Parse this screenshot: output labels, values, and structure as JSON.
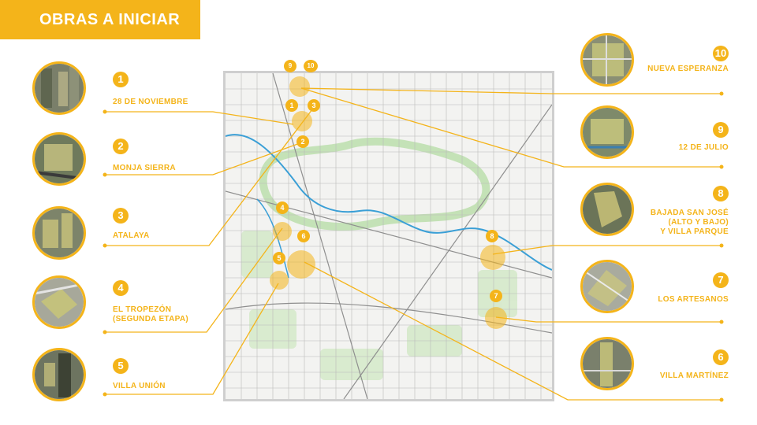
{
  "title": "OBRAS A INICIAR",
  "colors": {
    "accent": "#f4b41a",
    "map_bg": "#f3f3f1",
    "river": "#3a9fd6",
    "park": "#cfe6c4"
  },
  "projects": [
    {
      "number": "1",
      "name": "28 DE NOVIEMBRE"
    },
    {
      "number": "2",
      "name": "MONJA SIERRA"
    },
    {
      "number": "3",
      "name": "ATALAYA"
    },
    {
      "number": "4",
      "name": "EL TROPEZÓN\n(SEGUNDA ETAPA)"
    },
    {
      "number": "5",
      "name": "VILLA UNIÓN"
    },
    {
      "number": "6",
      "name": "VILLA MARTÍNEZ"
    },
    {
      "number": "7",
      "name": "LOS ARTESANOS"
    },
    {
      "number": "8",
      "name": "BAJADA SAN JOSÉ\n(ALTO Y BAJO)\nY VILLA PARQUE"
    },
    {
      "number": "9",
      "name": "12 DE JULIO"
    },
    {
      "number": "10",
      "name": "NUEVA ESPERANZA"
    }
  ],
  "map_markers": [
    "9",
    "10",
    "1",
    "3",
    "2",
    "4",
    "6",
    "5",
    "8",
    "7"
  ]
}
